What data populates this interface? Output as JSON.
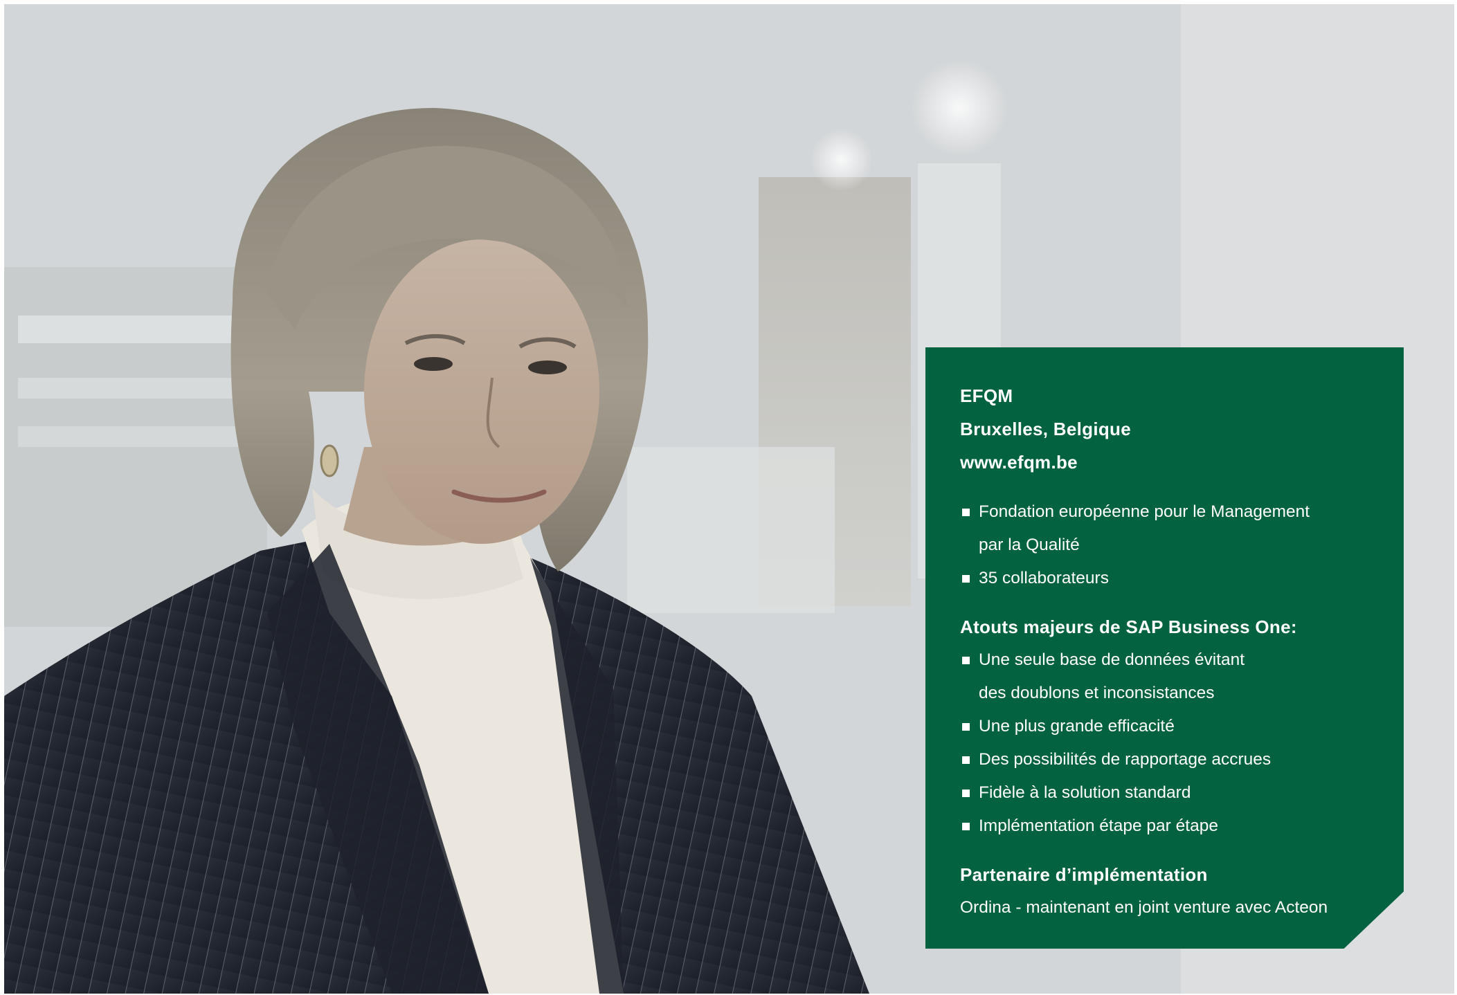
{
  "company": {
    "name": "EFQM",
    "location": "Bruxelles, Belgique",
    "website": "www.efqm.be"
  },
  "facts": [
    {
      "text": "Fondation européenne pour le Management",
      "continuation": "par la Qualité"
    },
    {
      "text": "35 collaborateurs"
    }
  ],
  "advantages": {
    "heading": "Atouts majeurs de SAP Business One:",
    "items": [
      {
        "text": "Une seule base de données évitant",
        "continuation": "des doublons et inconsistances"
      },
      {
        "text": "Une plus grande efficacité"
      },
      {
        "text": "Des possibilités de rapportage accrues"
      },
      {
        "text": "Fidèle à la solution standard"
      },
      {
        "text": "Implémentation étape par étape"
      }
    ]
  },
  "partner": {
    "heading": "Partenaire d’implémentation",
    "text": "Ordina - maintenant en joint venture avec Acteon"
  },
  "colors": {
    "panel_green": "#03623f",
    "text": "#ffffff"
  },
  "icons": {
    "bullet": "square-bullet-icon"
  }
}
